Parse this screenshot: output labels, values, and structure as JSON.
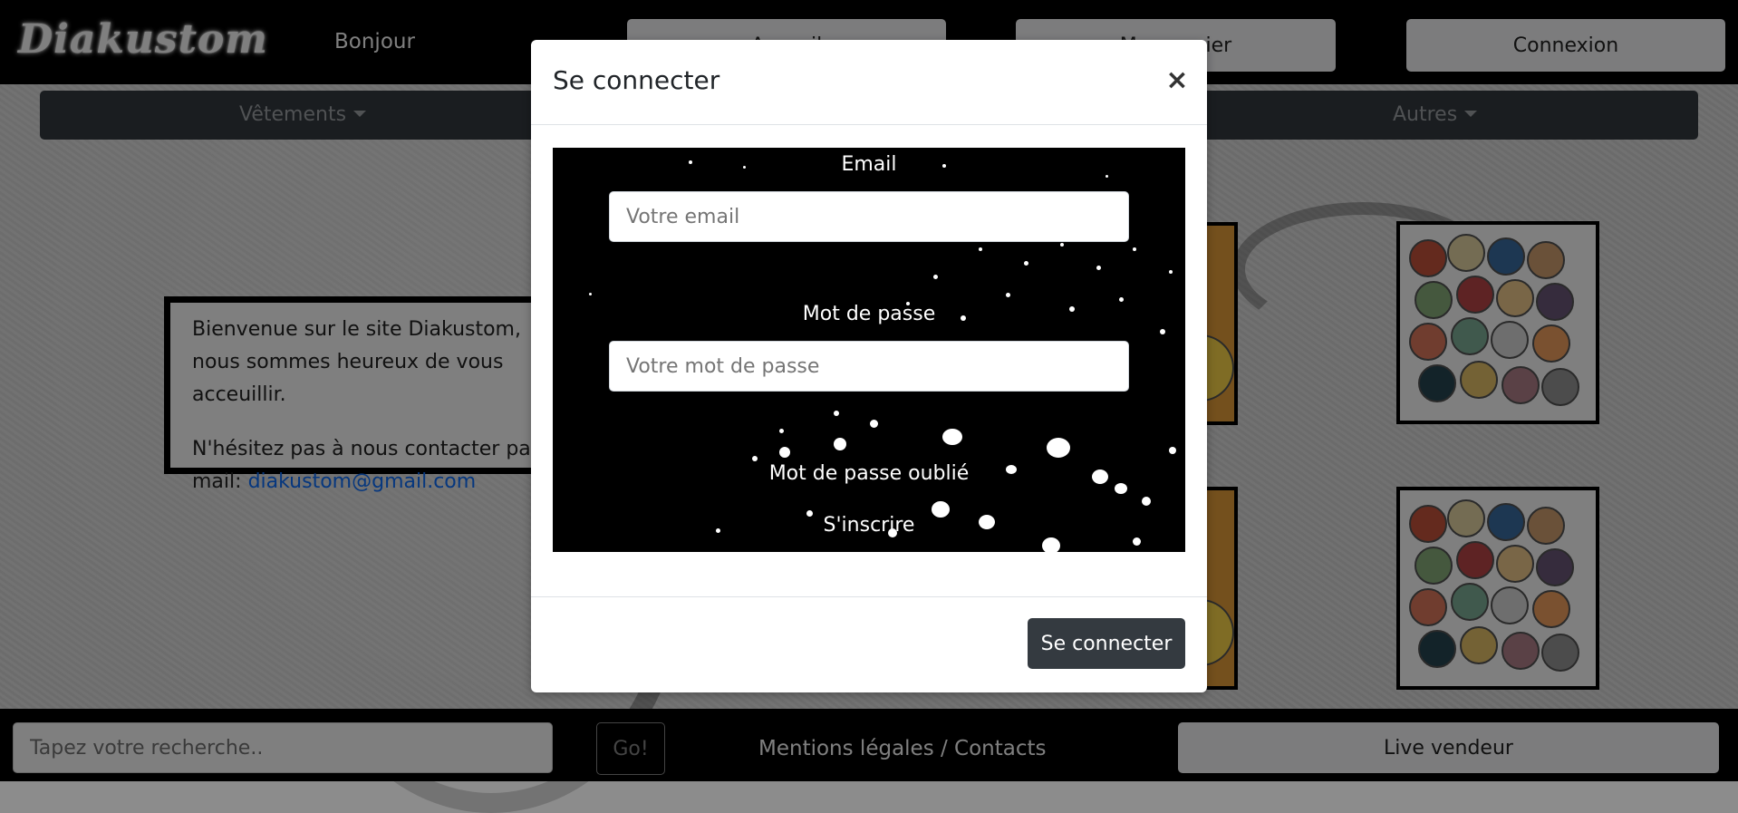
{
  "header": {
    "logo_text": "Diakustom",
    "greeting": "Bonjour",
    "btn_one_label": "Accueil",
    "btn_two_label": "Mon panier",
    "login_label": "Connexion"
  },
  "nav": {
    "items": [
      {
        "label": "Vêtements"
      },
      {
        "label": "Autres"
      }
    ]
  },
  "welcome": {
    "text_start": "Bienvenue sur le site Diakustom, nous sommes heureux de vous acceuillir.",
    "contact_start": "N'hésitez pas à nous contacter par mail:",
    "email": "diakustom@gmail.com"
  },
  "footer": {
    "search_placeholder": "Tapez votre recherche..",
    "go_label": "Go!",
    "legal_link": "Mentions légales / Contacts",
    "live_label": "Live vendeur"
  },
  "modal": {
    "title": "Se connecter",
    "close_symbol": "×",
    "email_label": "Email",
    "email_placeholder": "Votre email",
    "password_label": "Mot de passe",
    "password_placeholder": "Votre mot de passe",
    "forgot_link": "Mot de passe oublié",
    "register_link": "S'inscrire",
    "submit_label": "Se connecter"
  },
  "colors": {
    "topbar": "#000000",
    "navbar": "#343a40",
    "overlay": "rgba(0,0,0,0.5)",
    "submit": "#343a40",
    "link": "#0d6efd"
  }
}
